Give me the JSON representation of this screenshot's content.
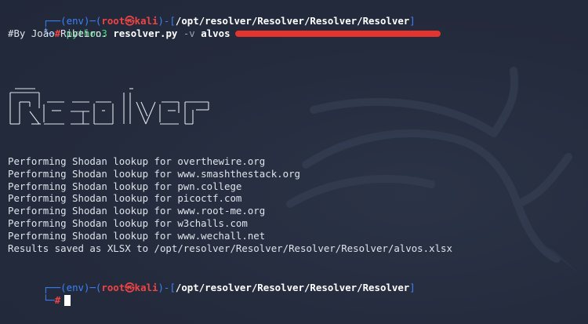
{
  "prompt": {
    "env": "(env)",
    "user": "root",
    "host_symbol": "㉿",
    "host": "kali",
    "path": "/opt/resolver/Resolver/Resolver/Resolver"
  },
  "command": {
    "binary": "python3",
    "script": "resolver.py",
    "flag": "-v",
    "arg": "alvos"
  },
  "author_line": "#By João Ribeiro.",
  "ascii_logo_name": "Resolver",
  "output_lines": [
    "Performing Shodan lookup for overthewire.org",
    "Performing Shodan lookup for www.smashthestack.org",
    "Performing Shodan lookup for pwn.college",
    "Performing Shodan lookup for picoctf.com",
    "Performing Shodan lookup for www.root-me.org",
    "Performing Shodan lookup for w3challs.com",
    "Performing Shodan lookup for www.wechall.net",
    "Results saved as XLSX to /opt/resolver/Resolver/Resolver/Resolver/alvos.xlsx"
  ],
  "prompt_symbol": "#",
  "colors": {
    "background": "#242b3d",
    "prompt_frame": "#3b82f6",
    "user_host": "#ef4444",
    "command": "#4ade80",
    "redaction": "#e3342f"
  }
}
